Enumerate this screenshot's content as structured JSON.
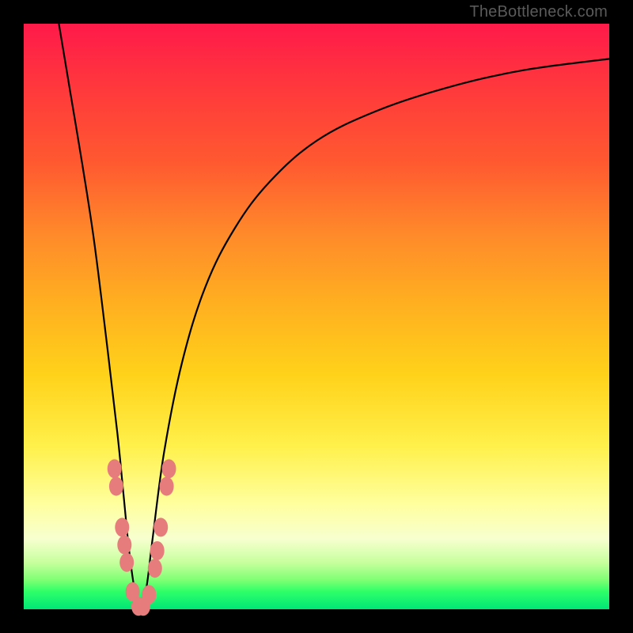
{
  "watermark": "TheBottleneck.com",
  "colors": {
    "background": "#000000",
    "gradient_top": "#ff1a4a",
    "gradient_mid": "#ffd21a",
    "gradient_bottom": "#00e676",
    "curve": "#000000",
    "dots": "#e77c7c"
  },
  "chart_data": {
    "type": "line",
    "title": "",
    "xlabel": "",
    "ylabel": "",
    "xlim": [
      0,
      100
    ],
    "ylim": [
      0,
      100
    ],
    "grid": false,
    "legend": false,
    "series": [
      {
        "name": "bottleneck-curve",
        "x": [
          6,
          8,
          10,
          12,
          14,
          16,
          17,
          18,
          19,
          20,
          21,
          22,
          24,
          27,
          31,
          36,
          42,
          50,
          60,
          72,
          85,
          100
        ],
        "y": [
          100,
          88,
          76,
          63,
          47,
          30,
          20,
          10,
          3,
          0,
          4,
          12,
          27,
          42,
          55,
          65,
          73,
          80,
          85,
          89,
          92,
          94
        ]
      }
    ],
    "points": [
      {
        "x": 15.5,
        "y": 24
      },
      {
        "x": 15.8,
        "y": 21
      },
      {
        "x": 16.8,
        "y": 14
      },
      {
        "x": 17.2,
        "y": 11
      },
      {
        "x": 17.6,
        "y": 8
      },
      {
        "x": 18.6,
        "y": 3
      },
      {
        "x": 19.6,
        "y": 0.5
      },
      {
        "x": 20.4,
        "y": 0.5
      },
      {
        "x": 21.4,
        "y": 2.5
      },
      {
        "x": 22.4,
        "y": 7
      },
      {
        "x": 22.8,
        "y": 10
      },
      {
        "x": 23.4,
        "y": 14
      },
      {
        "x": 24.4,
        "y": 21
      },
      {
        "x": 24.8,
        "y": 24
      }
    ]
  }
}
